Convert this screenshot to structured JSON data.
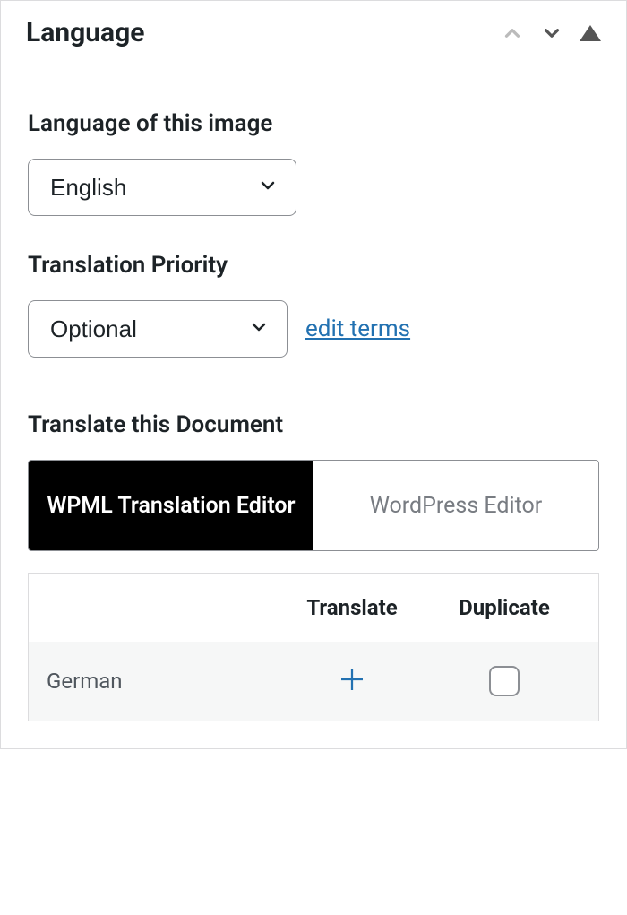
{
  "panel": {
    "title": "Language"
  },
  "language_of_image": {
    "label": "Language of this image",
    "value": "English"
  },
  "translation_priority": {
    "label": "Translation Priority",
    "value": "Optional",
    "edit_link": "edit terms"
  },
  "translate_document": {
    "label": "Translate this Document",
    "tabs": {
      "active": "WPML Translation Editor",
      "inactive": "WordPress Editor"
    },
    "columns": {
      "translate": "Translate",
      "duplicate": "Duplicate"
    },
    "rows": [
      {
        "language": "German"
      }
    ]
  }
}
